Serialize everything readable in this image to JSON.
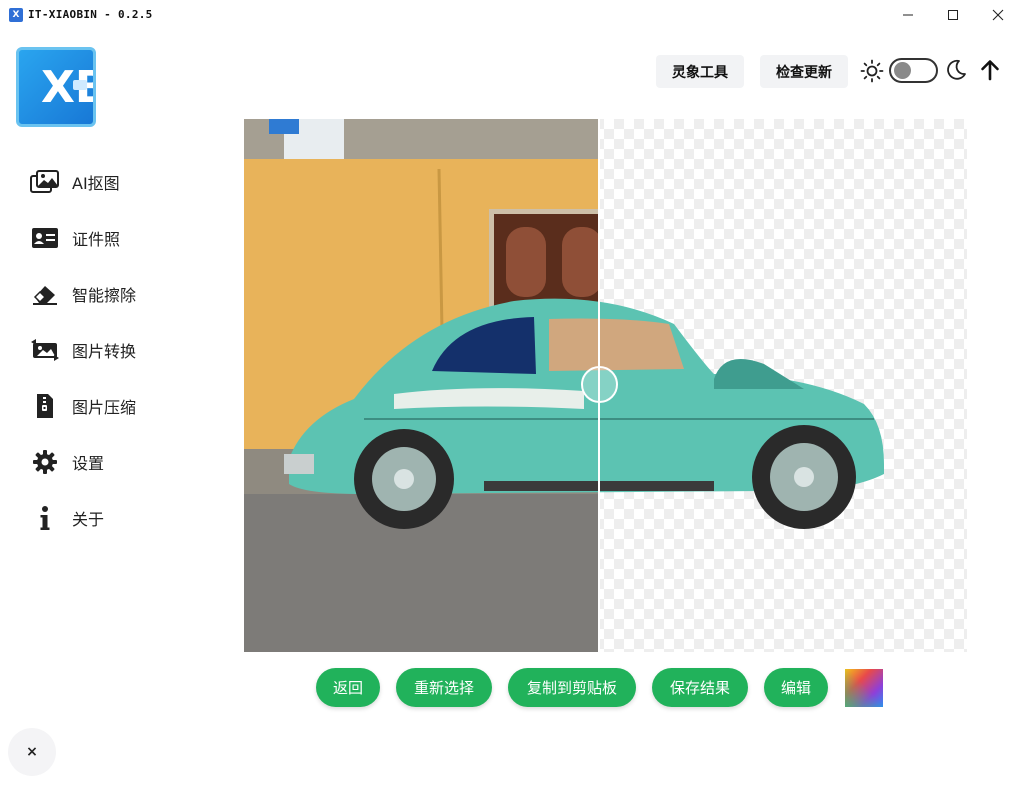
{
  "window": {
    "title": "IT-XIAOBIN - 0.2.5",
    "icon_text": "X"
  },
  "logo": {
    "letter": "XB"
  },
  "sidebar": {
    "items": [
      {
        "label": "AI抠图",
        "icon": "image-gallery-icon"
      },
      {
        "label": "证件照",
        "icon": "id-card-icon"
      },
      {
        "label": "智能擦除",
        "icon": "eraser-icon"
      },
      {
        "label": "图片转换",
        "icon": "image-convert-icon"
      },
      {
        "label": "图片压缩",
        "icon": "file-zip-icon"
      },
      {
        "label": "设置",
        "icon": "gear-icon"
      },
      {
        "label": "关于",
        "icon": "info-icon"
      }
    ]
  },
  "toolbar": {
    "tools_label": "灵象工具",
    "update_label": "检查更新",
    "theme_toggle_on": false
  },
  "compare": {
    "slider_position": 0.49
  },
  "actions": {
    "back": "返回",
    "reselect": "重新选择",
    "copy": "复制到剪贴板",
    "save": "保存结果",
    "edit": "编辑"
  },
  "colors": {
    "accent": "#21b25b",
    "car": "#5cc3b2",
    "wall": "#e8b35a"
  },
  "close_fab": "×"
}
